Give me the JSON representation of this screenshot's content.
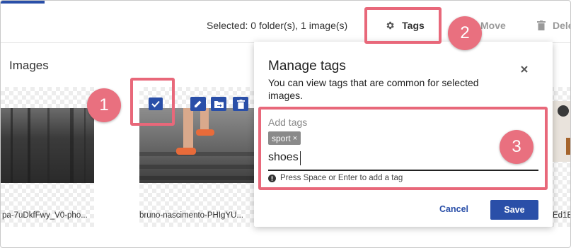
{
  "header": {
    "selection_summary": "Selected: 0 folder(s), 1 image(s)",
    "tags_label": "Tags",
    "move_label": "Move",
    "delete_label": "Dele"
  },
  "gallery": {
    "heading": "Images",
    "items": [
      {
        "caption": "pa-7uDkfFwy_V0-pho..."
      },
      {
        "caption": "bruno-nascimento-PHIgYU..."
      },
      {
        "caption": "Ed1E"
      }
    ]
  },
  "tag_popover": {
    "title": "Manage tags",
    "description": "You can view tags that are common for selected images.",
    "input_label": "Add tags",
    "existing_tags": [
      "sport"
    ],
    "chip_remove": "×",
    "input_value": "shoes",
    "hint": "Press Space or Enter to add a tag",
    "cancel_label": "Cancel",
    "save_label": "Save"
  },
  "annotations": {
    "step_1": "1",
    "step_2": "2",
    "step_3": "3"
  },
  "colors": {
    "accent": "#2a4fa8",
    "highlight": "#e8687a",
    "badge": "#e9707f"
  },
  "icons": [
    "settings-gear-icon",
    "trash-icon",
    "checkmark-icon",
    "pencil-icon",
    "folder-move-icon",
    "close-icon",
    "info-icon"
  ]
}
